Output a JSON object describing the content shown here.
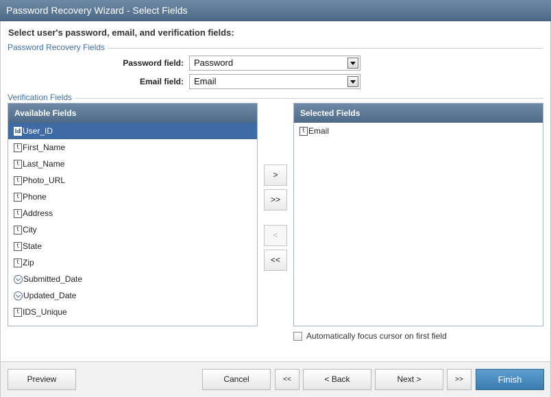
{
  "window": {
    "title": "Password Recovery Wizard - Select Fields"
  },
  "instructions": "Select user's password, email, and verification fields:",
  "recovery_fields": {
    "legend": "Password Recovery Fields",
    "password_label": "Password field:",
    "password_value": "Password",
    "email_label": "Email field:",
    "email_value": "Email"
  },
  "verification": {
    "legend": "Verification Fields",
    "available": {
      "header": "Available Fields",
      "items": [
        {
          "label": "User_ID",
          "icon": "id-field-icon",
          "selected": true
        },
        {
          "label": "First_Name",
          "icon": "text-field-icon"
        },
        {
          "label": "Last_Name",
          "icon": "text-field-icon"
        },
        {
          "label": "Photo_URL",
          "icon": "text-field-icon"
        },
        {
          "label": "Phone",
          "icon": "text-field-icon"
        },
        {
          "label": "Address",
          "icon": "text-field-icon"
        },
        {
          "label": "City",
          "icon": "text-field-icon"
        },
        {
          "label": "State",
          "icon": "text-field-icon"
        },
        {
          "label": "Zip",
          "icon": "text-field-icon"
        },
        {
          "label": "Submitted_Date",
          "icon": "date-field-icon"
        },
        {
          "label": "Updated_Date",
          "icon": "date-field-icon"
        },
        {
          "label": "IDS_Unique",
          "icon": "text-field-icon"
        }
      ]
    },
    "selected": {
      "header": "Selected Fields",
      "items": [
        {
          "label": "Email",
          "icon": "text-field-icon"
        }
      ]
    },
    "buttons": {
      "add": ">",
      "add_all": ">>",
      "remove": "<",
      "remove_all": "<<"
    },
    "autofocus_label": "Automatically focus cursor on first field",
    "autofocus_checked": false
  },
  "footer": {
    "preview": "Preview",
    "cancel": "Cancel",
    "first": "<<",
    "back": "< Back",
    "next": "Next >",
    "last": ">>",
    "finish": "Finish"
  },
  "colors": {
    "header": "#5a7593",
    "selection": "#3e6aa6",
    "finish": "#4a8dc2",
    "legend": "#3f6ea0"
  }
}
